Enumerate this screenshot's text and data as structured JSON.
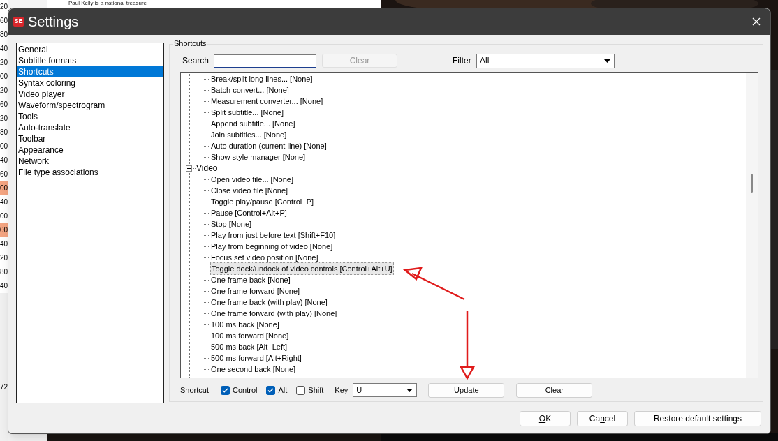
{
  "background": {
    "caption": "Paul Kelly is a national treasure",
    "rows": [
      {
        "text": "20",
        "highlighted": false
      },
      {
        "text": "60",
        "highlighted": false
      },
      {
        "text": "80",
        "highlighted": false
      },
      {
        "text": "40",
        "highlighted": false
      },
      {
        "text": "20",
        "highlighted": false
      },
      {
        "text": "00",
        "highlighted": false
      },
      {
        "text": "20",
        "highlighted": false
      },
      {
        "text": "60",
        "highlighted": false
      },
      {
        "text": "20",
        "highlighted": false
      },
      {
        "text": "80",
        "highlighted": false
      },
      {
        "text": "00",
        "highlighted": false
      },
      {
        "text": "40",
        "highlighted": false
      },
      {
        "text": "60",
        "highlighted": false
      },
      {
        "text": "00",
        "highlighted": true
      },
      {
        "text": "40",
        "highlighted": false
      },
      {
        "text": "00",
        "highlighted": false
      },
      {
        "text": "00",
        "highlighted": true
      },
      {
        "text": "40",
        "highlighted": false
      },
      {
        "text": "20",
        "highlighted": false
      },
      {
        "text": "80",
        "highlighted": false
      },
      {
        "text": "40",
        "highlighted": false
      }
    ],
    "bottom_text": "72"
  },
  "window": {
    "logo": "SE",
    "title": "Settings"
  },
  "sidebar": {
    "items": [
      {
        "label": "General",
        "selected": false
      },
      {
        "label": "Subtitle formats",
        "selected": false
      },
      {
        "label": "Shortcuts",
        "selected": true
      },
      {
        "label": "Syntax coloring",
        "selected": false
      },
      {
        "label": "Video player",
        "selected": false
      },
      {
        "label": "Waveform/spectrogram",
        "selected": false
      },
      {
        "label": "Tools",
        "selected": false
      },
      {
        "label": "Auto-translate",
        "selected": false
      },
      {
        "label": "Toolbar",
        "selected": false
      },
      {
        "label": "Appearance",
        "selected": false
      },
      {
        "label": "Network",
        "selected": false
      },
      {
        "label": "File type associations",
        "selected": false
      }
    ]
  },
  "shortcuts": {
    "group_title": "Shortcuts",
    "search_label": "Search",
    "clear_button": "Clear",
    "filter_label": "Filter",
    "filter_value": "All",
    "tree": [
      {
        "children": [
          {
            "label": "Break/split long lines... [None]",
            "selected": false
          },
          {
            "label": "Batch convert... [None]",
            "selected": false
          },
          {
            "label": "Measurement converter... [None]",
            "selected": false
          },
          {
            "label": "Split subtitle... [None]",
            "selected": false
          },
          {
            "label": "Append subtitle... [None]",
            "selected": false
          },
          {
            "label": "Join subtitles... [None]",
            "selected": false
          },
          {
            "label": "Auto duration (current line) [None]",
            "selected": false
          },
          {
            "label": "Show style manager [None]",
            "selected": false
          }
        ]
      },
      {
        "label": "Video",
        "expanded": true,
        "children": [
          {
            "label": "Open video file... [None]",
            "selected": false
          },
          {
            "label": "Close video file [None]",
            "selected": false
          },
          {
            "label": "Toggle play/pause [Control+P]",
            "selected": false
          },
          {
            "label": "Pause [Control+Alt+P]",
            "selected": false
          },
          {
            "label": "Stop [None]",
            "selected": false
          },
          {
            "label": "Play from just before text [Shift+F10]",
            "selected": false
          },
          {
            "label": "Play from beginning of video [None]",
            "selected": false
          },
          {
            "label": "Focus set video position [None]",
            "selected": false
          },
          {
            "label": "Toggle dock/undock of video controls [Control+Alt+U]",
            "selected": true
          },
          {
            "label": "One frame back [None]",
            "selected": false
          },
          {
            "label": "One frame forward [None]",
            "selected": false
          },
          {
            "label": "One frame back (with play) [None]",
            "selected": false
          },
          {
            "label": "One frame forward (with play) [None]",
            "selected": false
          },
          {
            "label": "100 ms back [None]",
            "selected": false
          },
          {
            "label": "100 ms forward [None]",
            "selected": false
          },
          {
            "label": "500 ms back [Alt+Left]",
            "selected": false
          },
          {
            "label": "500 ms forward [Alt+Right]",
            "selected": false
          },
          {
            "label": "One second back [None]",
            "selected": false
          }
        ]
      }
    ],
    "shortcut_label": "Shortcut",
    "modifiers": [
      {
        "label": "Control",
        "checked": true
      },
      {
        "label": "Alt",
        "checked": true
      },
      {
        "label": "Shift",
        "checked": false
      }
    ],
    "key_label": "Key",
    "key_value": "U",
    "update_button": "Update",
    "clear_shortcut_button": "Clear"
  },
  "buttons": [
    {
      "key": "O",
      "after": "K"
    },
    {
      "before": "Ca",
      "key": "n",
      "after": "cel"
    },
    {
      "before": "Restore default settings"
    }
  ]
}
